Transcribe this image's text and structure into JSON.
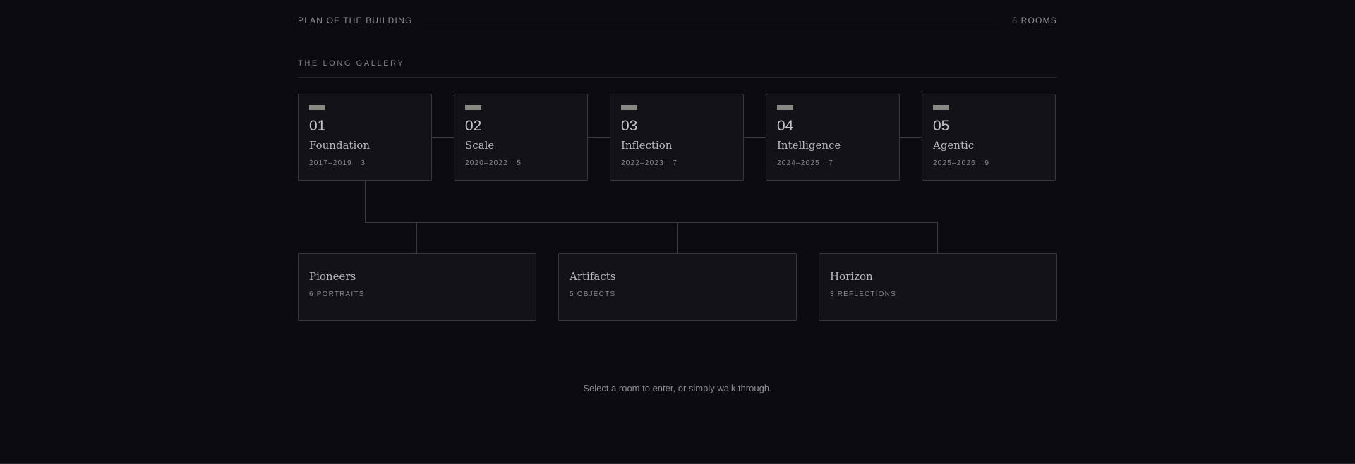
{
  "plan": {
    "title": "PLAN OF THE BUILDING",
    "room_count": "8 ROOMS"
  },
  "gallery": {
    "label": "THE LONG GALLERY",
    "rooms": [
      {
        "number": "01",
        "name": "Foundation",
        "meta": "2017–2019 · 3"
      },
      {
        "number": "02",
        "name": "Scale",
        "meta": "2020–2022 · 5"
      },
      {
        "number": "03",
        "name": "Inflection",
        "meta": "2022–2023 · 7"
      },
      {
        "number": "04",
        "name": "Intelligence",
        "meta": "2024–2025 · 7"
      },
      {
        "number": "05",
        "name": "Agentic",
        "meta": "2025–2026 · 9"
      }
    ]
  },
  "wings": [
    {
      "name": "Pioneers",
      "meta": "6 PORTRAITS"
    },
    {
      "name": "Artifacts",
      "meta": "5 OBJECTS"
    },
    {
      "name": "Horizon",
      "meta": "3 REFLECTIONS"
    }
  ],
  "hint": "Select a room to enter, or simply walk through.",
  "colors": {
    "background": "#0b0b11",
    "card": "#121218",
    "border": "#37373e",
    "swatch": "#8a8883"
  }
}
